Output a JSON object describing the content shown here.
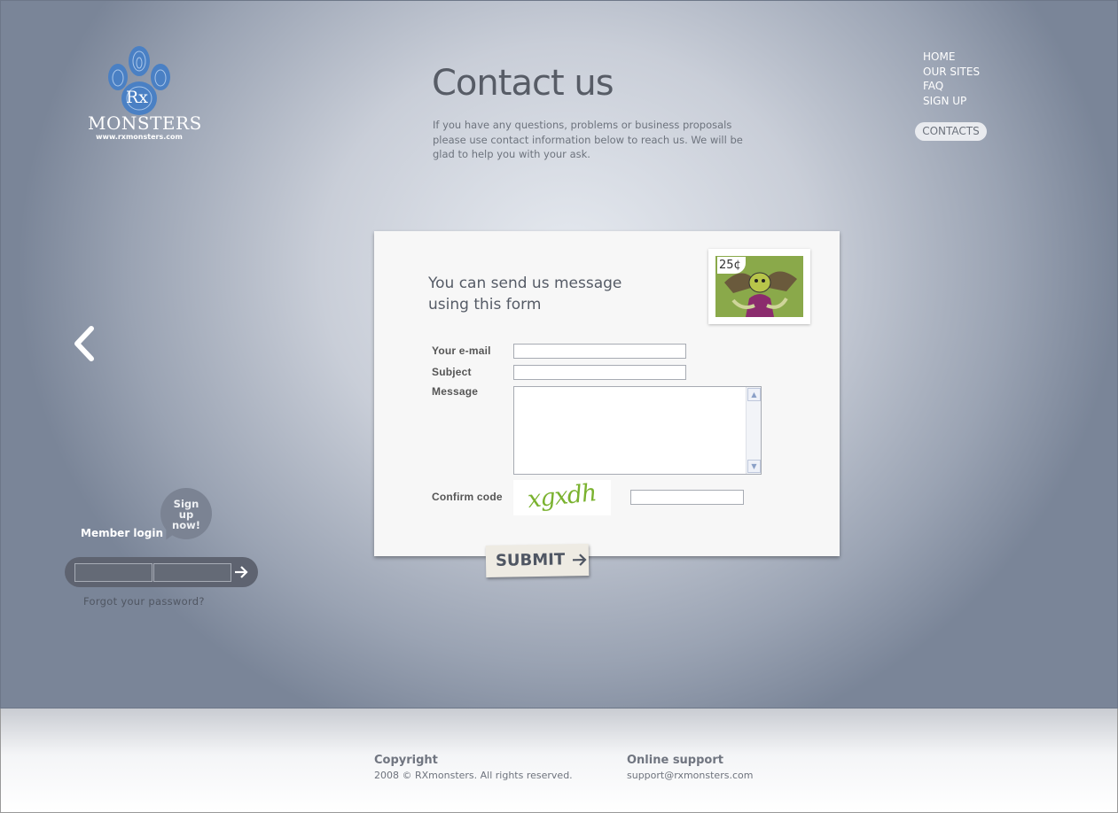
{
  "logo": {
    "name": "Monsters",
    "monogram": "Rx",
    "url": "www.rxmonsters.com"
  },
  "page": {
    "title": "Contact us",
    "intro": "If you have any questions, problems or business proposals please use contact information below to reach us. We will be glad to help you with your ask."
  },
  "nav": {
    "items": [
      "HOME",
      "OUR SITES",
      "FAQ",
      "SIGN UP"
    ],
    "active": "CONTACTS"
  },
  "form": {
    "heading_line1": "You can send us message",
    "heading_line2": "using this form",
    "stamp_price": "25¢",
    "email_label": "Your e-mail",
    "subject_label": "Subject",
    "message_label": "Message",
    "confirm_label": "Confirm code",
    "captcha_text": "xgxdh",
    "email_value": "",
    "subject_value": "",
    "message_value": "",
    "confirm_value": "",
    "submit_label": "SUBMIT"
  },
  "login": {
    "bubble_line1": "Sign",
    "bubble_line2": "up",
    "bubble_line3": "now!",
    "member_login": "Member login",
    "username_value": "",
    "password_value": "",
    "forgot": "Forgot your password?"
  },
  "footer": {
    "copyright_heading": "Copyright",
    "copyright_text": "2008 © RXmonsters. All rights reserved.",
    "support_heading": "Online support",
    "support_email": "support@rxmonsters.com"
  },
  "colors": {
    "accent_blue": "#4a80c4",
    "captcha_green": "#7ab22f"
  }
}
